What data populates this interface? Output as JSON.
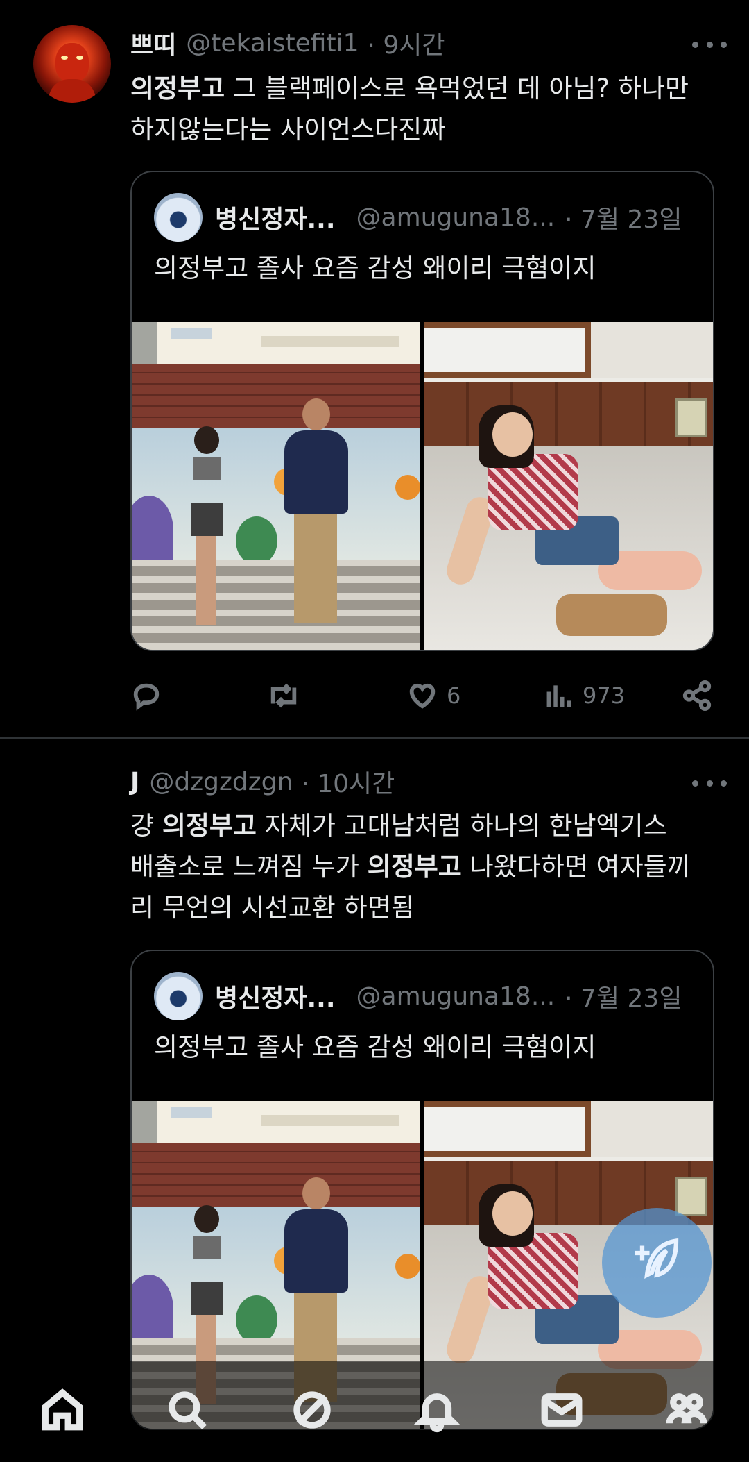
{
  "tweet1": {
    "name": "쁘띠",
    "handle": "@tekaistefiti1",
    "time": "· 9시간",
    "text_pre": "의정부고",
    "text_post_line1": " 그 블랙페이스로 욕먹었던 데 아님? 하나만",
    "text_line2": "하지않는다는 사이언스다진짜",
    "quote": {
      "name": "병신정자...",
      "handle": "@amuguna18...",
      "date": "· 7월 23일",
      "text": "의정부고 졸사 요즘 감성 왜이리 극혐이지"
    },
    "actions": {
      "reply_count": "",
      "retweet_count": "",
      "like_count": "6",
      "views_count": "973"
    }
  },
  "tweet2": {
    "name": "J",
    "handle": "@dzgzdzgn",
    "time": "· 10시간",
    "line1_a": "걍 ",
    "line1_b": "의정부고",
    "line1_c": " 자체가 고대남처럼 하나의 한남엑기스",
    "line2_a": "배출소로 느껴짐 누가 ",
    "line2_b": "의정부고",
    "line2_c": " 나왔다하면 여자들끼",
    "line3": "리 무언의 시선교환 하면됨",
    "quote": {
      "name": "병신정자...",
      "handle": "@amuguna18...",
      "date": "· 7월 23일",
      "text": "의정부고 졸사 요즘 감성 왜이리 극혐이지"
    }
  },
  "icons": {
    "more": "more-icon",
    "reply": "reply-icon",
    "retweet": "retweet-icon",
    "like": "heart-icon",
    "views": "views-icon",
    "share": "share-icon",
    "compose": "compose-icon",
    "nav": [
      "home-icon",
      "search-icon",
      "grok-icon",
      "notifications-icon",
      "messages-icon",
      "communities-icon"
    ]
  },
  "colors": {
    "background": "#000000",
    "text": "#e7e9ea",
    "muted": "#71767b",
    "border": "#3c4044",
    "fab": "#5294d2"
  }
}
